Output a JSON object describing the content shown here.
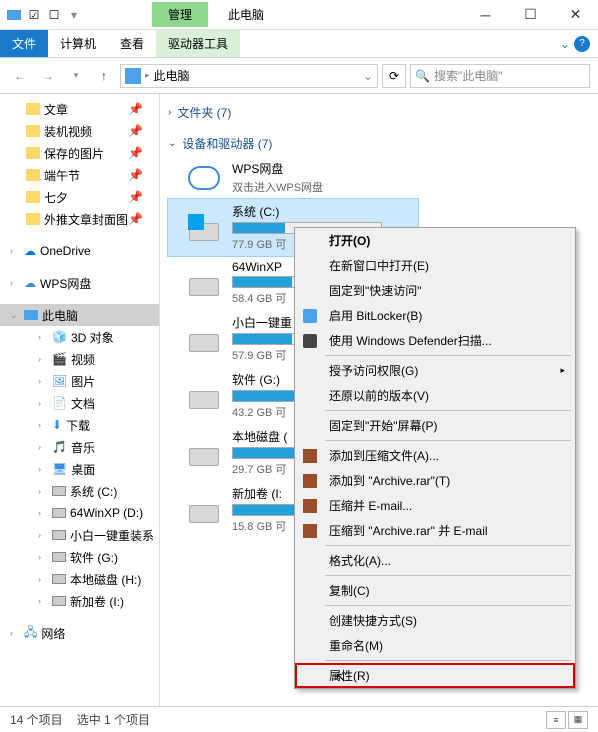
{
  "title": {
    "manage_tab": "管理",
    "title_text": "此电脑"
  },
  "ribbon": {
    "file": "文件",
    "computer": "计算机",
    "view": "查看",
    "driver_tools": "驱动器工具"
  },
  "nav": {
    "location": "此电脑",
    "search_placeholder": "搜索\"此电脑\""
  },
  "sidebar": {
    "quick": [
      "文章",
      "装机视频",
      "保存的图片",
      "端午节",
      "七夕",
      "外推文章封面图"
    ],
    "onedrive": "OneDrive",
    "wps": "WPS网盘",
    "thispc": "此电脑",
    "pc_children": [
      "3D 对象",
      "视频",
      "图片",
      "文档",
      "下载",
      "音乐",
      "桌面"
    ],
    "drives": [
      "系统 (C:)",
      "64WinXP  (D:)",
      "小白一键重装系",
      "软件 (G:)",
      "本地磁盘 (H:)",
      "新加卷 (I:)"
    ],
    "network": "网络"
  },
  "groups": {
    "folders": "文件夹 (7)",
    "devices": "设备和驱动器 (7)"
  },
  "wps_drive": {
    "name": "WPS网盘",
    "sub": "双击进入WPS网盘"
  },
  "drives": [
    {
      "name": "系统 (C:)",
      "sub": "77.9 GB 可",
      "pct": 35,
      "win": true
    },
    {
      "name": "64WinXP",
      "sub": "58.4 GB 可",
      "pct": 40
    },
    {
      "name": "小白一键重",
      "sub": "57.9 GB 可",
      "pct": 40
    },
    {
      "name": "软件 (G:)",
      "sub": "43.2 GB 可",
      "pct": 55
    },
    {
      "name": "本地磁盘 (",
      "sub": "29.7 GB 可",
      "pct": 70
    },
    {
      "name": "新加卷 (I:",
      "sub": "15.8 GB 可",
      "pct": 85
    }
  ],
  "ctx": {
    "open": "打开(O)",
    "open_new": "在新窗口中打开(E)",
    "pin_quick": "固定到\"快速访问\"",
    "bitlocker": "启用 BitLocker(B)",
    "defender": "使用 Windows Defender扫描...",
    "grant": "授予访问权限(G)",
    "restore": "还原以前的版本(V)",
    "pin_start": "固定到\"开始\"屏幕(P)",
    "add_archive": "添加到压缩文件(A)...",
    "add_rar": "添加到 \"Archive.rar\"(T)",
    "compress_email": "压缩并 E-mail...",
    "compress_rar_email": "压缩到 \"Archive.rar\" 并 E-mail",
    "format": "格式化(A)...",
    "copy": "复制(C)",
    "shortcut": "创建快捷方式(S)",
    "rename": "重命名(M)",
    "props": "属性(R)"
  },
  "status": {
    "count": "14 个项目",
    "sel": "选中 1 个项目"
  }
}
